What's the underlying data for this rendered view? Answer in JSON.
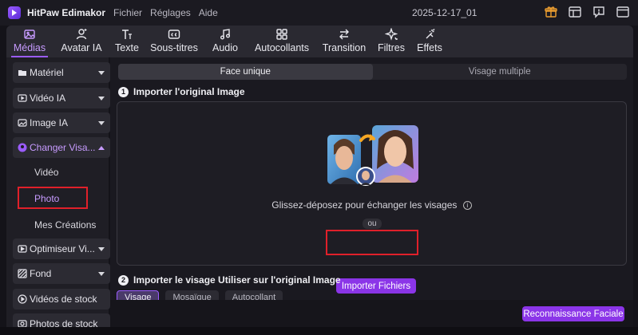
{
  "app": {
    "title": "HitPaw Edimakor",
    "menu": [
      "Fichier",
      "Réglages",
      "Aide"
    ],
    "project_name": "2025-12-17_01"
  },
  "titlebar_icons": [
    "gift-icon",
    "layout-icon",
    "chat-icon",
    "window-icon"
  ],
  "toolbar": [
    {
      "label": "Médias",
      "icon": "media-icon",
      "active": true
    },
    {
      "label": "Avatar IA",
      "icon": "avatar-icon",
      "active": false
    },
    {
      "label": "Texte",
      "icon": "text-icon",
      "active": false
    },
    {
      "label": "Sous-titres",
      "icon": "subtitles-icon",
      "active": false
    },
    {
      "label": "Audio",
      "icon": "audio-icon",
      "active": false
    },
    {
      "label": "Autocollants",
      "icon": "stickers-icon",
      "active": false
    },
    {
      "label": "Transition",
      "icon": "transition-icon",
      "active": false
    },
    {
      "label": "Filtres",
      "icon": "filters-icon",
      "active": false
    },
    {
      "label": "Effets",
      "icon": "effects-icon",
      "active": false
    }
  ],
  "sidebar": {
    "items": [
      {
        "label": "Matériel",
        "icon": "folder-icon"
      },
      {
        "label": "Vidéo IA",
        "icon": "video-ai-icon"
      },
      {
        "label": "Image IA",
        "icon": "image-ai-icon"
      },
      {
        "label": "Changer Visa...",
        "icon": "face-swap-icon",
        "active": true,
        "expanded": true
      },
      {
        "label": "Optimiseur Vi...",
        "icon": "optimizer-icon"
      },
      {
        "label": "Fond",
        "icon": "background-icon"
      },
      {
        "label": "Vidéos de stock",
        "icon": "stock-video-icon"
      },
      {
        "label": "Photos de stock",
        "icon": "stock-photo-icon"
      }
    ],
    "sub_items": [
      {
        "label": "Vidéo",
        "active": false
      },
      {
        "label": "Photo",
        "active": true
      },
      {
        "label": "Mes Créations",
        "active": false
      }
    ]
  },
  "main": {
    "mode_tabs": [
      {
        "label": "Face unique",
        "active": true
      },
      {
        "label": "Visage multiple",
        "active": false
      }
    ],
    "step1": {
      "number": "1",
      "title": "Importer l'original Image"
    },
    "dropzone": {
      "hint": "Glissez-déposez pour échanger les visages",
      "info_glyph": "i",
      "or_label": "ou",
      "import_button": "Importer Fichiers"
    },
    "step2": {
      "number": "2",
      "title": "Importer le visage Utiliser sur l'original Image"
    },
    "face_tabs": [
      {
        "label": "Visage",
        "active": true
      },
      {
        "label": "Mosaïque",
        "active": false
      },
      {
        "label": "Autocollant",
        "active": false
      }
    ],
    "recognition_button": "Reconnaissance Faciale"
  },
  "colors": {
    "accent": "#9b5cff",
    "button": "#8b35e8",
    "highlight": "#e0202a",
    "background": "#141319"
  }
}
